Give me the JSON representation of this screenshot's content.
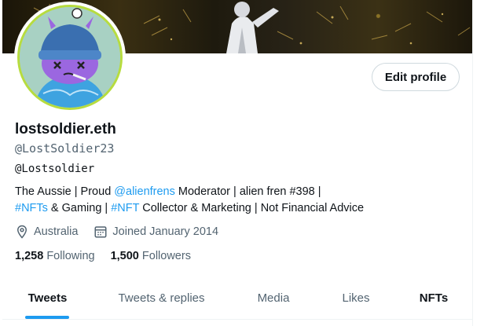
{
  "profile": {
    "display_name": "lostsoldier.eth",
    "handle": "@LostSoldier23",
    "alt_handle": "@Lostsoldier",
    "bio": {
      "p1": "The Aussie | Proud ",
      "mention": "@alienfrens",
      "p2": " Moderator | alien fren #398 |",
      "tag1": "#NFTs",
      "p3": " & Gaming | ",
      "tag2": "#NFT",
      "p4": " Collector & Marketing | Not Financial Advice"
    },
    "location": "Australia",
    "joined": "Joined January 2014",
    "following_count": "1,258",
    "following_label": "Following",
    "followers_count": "1,500",
    "followers_label": "Followers"
  },
  "actions": {
    "edit_profile": "Edit profile"
  },
  "tabs": [
    "Tweets",
    "Tweets & replies",
    "Media",
    "Likes",
    "NFTs"
  ],
  "active_tab": "Tweets",
  "icons": {
    "location": "location-pin-icon",
    "calendar": "calendar-icon"
  },
  "colors": {
    "accent": "#1d9bf0",
    "avatar_ring": "#b7dc3f",
    "text_secondary": "#536471"
  }
}
